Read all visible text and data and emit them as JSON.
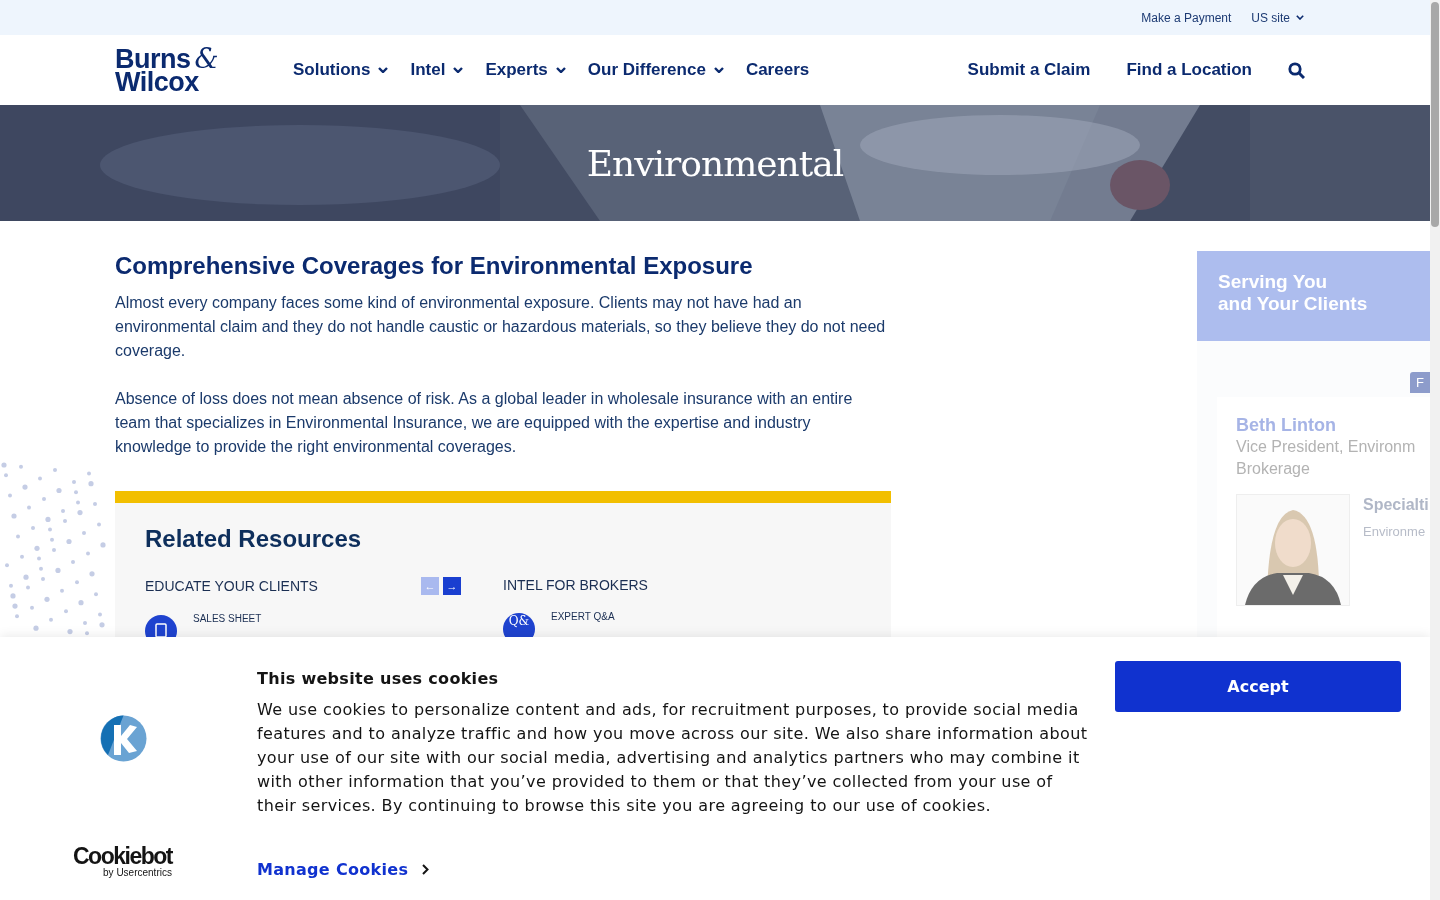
{
  "top_bar": {
    "links": [
      {
        "label": "Make a Payment",
        "dropdown": false
      },
      {
        "label": "US site",
        "dropdown": true
      }
    ]
  },
  "header": {
    "logo": {
      "line_1": "Burns",
      "ampersand": "&",
      "line_2": "Wilcox"
    },
    "nav": [
      {
        "label": "Solutions",
        "dropdown": true
      },
      {
        "label": "Intel",
        "dropdown": true
      },
      {
        "label": "Experts",
        "dropdown": true
      },
      {
        "label": "Our Difference",
        "dropdown": true
      },
      {
        "label": "Careers",
        "dropdown": false
      }
    ],
    "actions": [
      "Submit a Claim",
      "Find a Location"
    ]
  },
  "hero": {
    "title": "Environmental"
  },
  "intro": {
    "heading": "Comprehensive Coverages for Environmental Exposure",
    "paragraphs": [
      "Almost every company faces some kind of environmental exposure. Clients may not have had an environmental claim and they do not handle caustic or hazardous materials, so they believe they do not need coverage.",
      "Absence of loss does not mean absence of risk. As a global leader in wholesale insurance with an entire team that specializes in Environmental Insurance, we are equipped with the expertise and industry knowledge to provide the right environmental coverages."
    ]
  },
  "related_resources": {
    "title": "Related Resources",
    "columns": [
      {
        "heading": "EDUCATE YOUR CLIENTS",
        "arrows": [
          {
            "label": "←",
            "disabled": true
          },
          {
            "label": "→",
            "disabled": false
          }
        ],
        "items": [
          {
            "kind": "document",
            "type": "SALES SHEET"
          }
        ]
      },
      {
        "heading": "INTEL FOR BROKERS",
        "items": [
          {
            "kind": "badge",
            "badge": "Q&",
            "type": "EXPERT Q&A"
          }
        ]
      }
    ]
  },
  "sidebar": {
    "title_lines": [
      "Serving You",
      "and Your Clients"
    ],
    "tag": "F",
    "expert": {
      "name": "Beth Linton",
      "title_lines": [
        "Vice President, Environm",
        "Brokerage"
      ],
      "specialties_label": "Specialti",
      "specialty": "Environme"
    }
  },
  "cookie_banner": {
    "title": "This website uses cookies",
    "body": "We use cookies to personalize content and ads, for recruitment purposes, to provide social media features and to analyze traffic and how you move across our site. We also share information about your use of our site with our social media, advertising and analytics partners who may combine it with other information that you’ve provided to them or that they’ve collected from your use of their services. By continuing to browse this site you are agreeing to our use of cookies.",
    "manage_link": "Manage Cookies",
    "accept_button": "Accept",
    "brand": {
      "name": "Cookiebot",
      "tagline": "by Usercentrics"
    }
  }
}
